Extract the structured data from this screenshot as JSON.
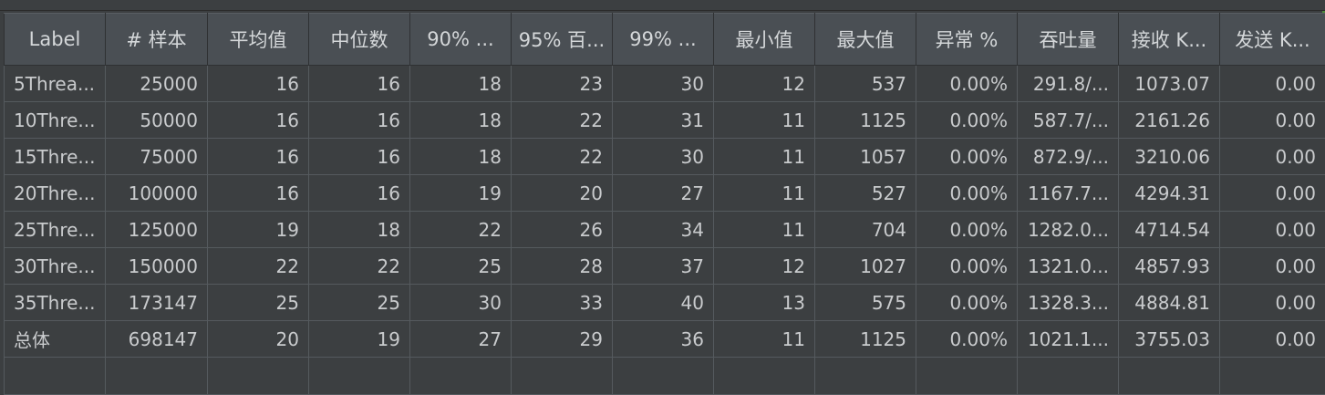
{
  "table": {
    "columns": [
      {
        "label": "Label"
      },
      {
        "label": "# 样本"
      },
      {
        "label": "平均值"
      },
      {
        "label": "中位数"
      },
      {
        "label": "90% ..."
      },
      {
        "label": "95% 百..."
      },
      {
        "label": "99% ..."
      },
      {
        "label": "最小值"
      },
      {
        "label": "最大值"
      },
      {
        "label": "异常 %"
      },
      {
        "label": "吞吐量"
      },
      {
        "label": "接收 K..."
      },
      {
        "label": "发送 K..."
      }
    ],
    "rows": [
      [
        "5Threa...",
        "25000",
        "16",
        "16",
        "18",
        "23",
        "30",
        "12",
        "537",
        "0.00%",
        "291.8/...",
        "1073.07",
        "0.00"
      ],
      [
        "10Thre...",
        "50000",
        "16",
        "16",
        "18",
        "22",
        "31",
        "11",
        "1125",
        "0.00%",
        "587.7/...",
        "2161.26",
        "0.00"
      ],
      [
        "15Thre...",
        "75000",
        "16",
        "16",
        "18",
        "22",
        "30",
        "11",
        "1057",
        "0.00%",
        "872.9/...",
        "3210.06",
        "0.00"
      ],
      [
        "20Thre...",
        "100000",
        "16",
        "16",
        "19",
        "20",
        "27",
        "11",
        "527",
        "0.00%",
        "1167.7...",
        "4294.31",
        "0.00"
      ],
      [
        "25Thre...",
        "125000",
        "19",
        "18",
        "22",
        "26",
        "34",
        "11",
        "704",
        "0.00%",
        "1282.0...",
        "4714.54",
        "0.00"
      ],
      [
        "30Thre...",
        "150000",
        "22",
        "22",
        "25",
        "28",
        "37",
        "12",
        "1027",
        "0.00%",
        "1321.0...",
        "4857.93",
        "0.00"
      ],
      [
        "35Thre...",
        "173147",
        "25",
        "25",
        "30",
        "33",
        "40",
        "13",
        "575",
        "0.00%",
        "1328.3...",
        "4884.81",
        "0.00"
      ],
      [
        "总体",
        "698147",
        "20",
        "19",
        "27",
        "29",
        "36",
        "11",
        "1125",
        "0.00%",
        "1021.1...",
        "3755.03",
        "0.00"
      ]
    ]
  },
  "colors": {
    "background": "#3c3f41",
    "header_background": "#4a4f54",
    "grid_line": "#555a5e",
    "text": "#c9cbcd",
    "accent": "#4e8a3a"
  }
}
